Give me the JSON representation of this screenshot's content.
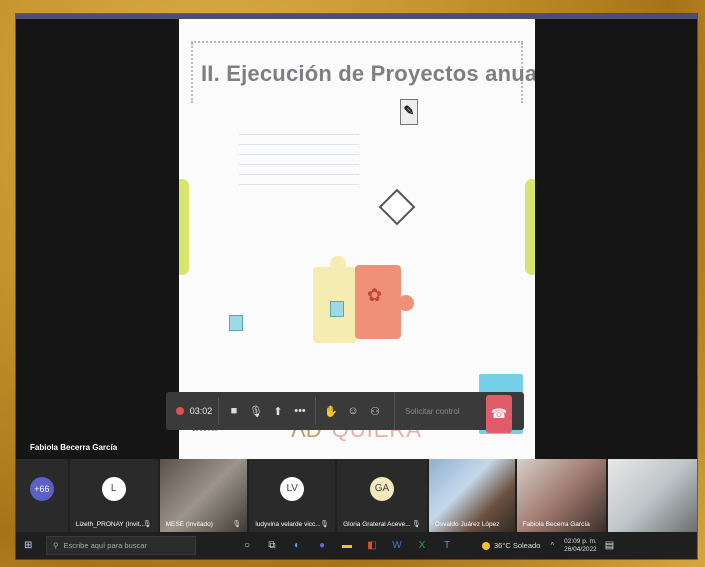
{
  "slide": {
    "title": "II. Ejecución de Proyectos anuales",
    "logo_text": "QUIERA"
  },
  "speaker": "Fabiola Becerra García",
  "controls": {
    "timer": "03:02",
    "request_control": "Solicitar control"
  },
  "gallery": {
    "more_count": "+66",
    "tiles": [
      {
        "initials": "L",
        "name": "Lizeth_PRONAY (Invit..."
      },
      {
        "initials": "",
        "name": "MESE (Invitado)"
      },
      {
        "initials": "LV",
        "name": "ludyvina velarde vicc..."
      },
      {
        "initials": "GA",
        "name": "Gloria Grateral Aceve..."
      },
      {
        "initials": "",
        "name": "Osvaldo Juárez López"
      },
      {
        "initials": "",
        "name": "Fabiola Becerra García"
      },
      {
        "initials": "",
        "name": ""
      }
    ]
  },
  "taskbar": {
    "search_placeholder": "Escribe aquí para buscar",
    "weather": "36°C  Soleado",
    "time": "02:09 p. m.",
    "date": "26/04/2022"
  }
}
